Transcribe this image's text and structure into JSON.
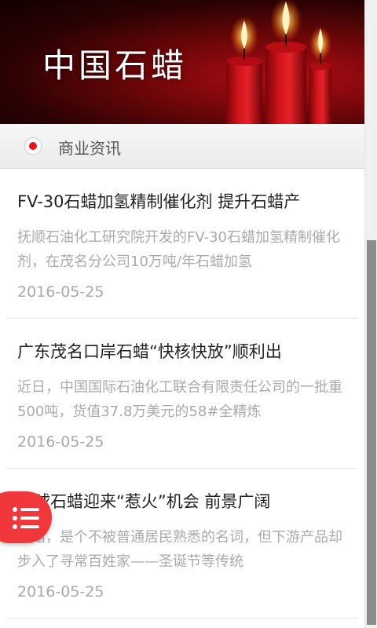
{
  "banner": {
    "title": "中国石蜡"
  },
  "section": {
    "title": "商业资讯"
  },
  "news": [
    {
      "title": "FV-30石蜡加氢精制催化剂 提升石蜡产",
      "summary": "抚顺石油化工研究院开发的FV-30石蜡加氢精制催化剂，在茂名分公司10万吨/年石蜡加氢",
      "date": "2016-05-25"
    },
    {
      "title": "广东茂名口岸石蜡“快核快放”顺利出",
      "summary": "近日，中国国际石油化工联合有限责任公司的一批重500吨，货值37.8万美元的58#全精炼",
      "date": "2016-05-25"
    },
    {
      "title": "全球石蜡迎来“惹火”机会 前景广阔",
      "summary": "石蜡，是个不被普通居民熟悉的名词，但下游产品却步入了寻常百姓家——圣诞节等传统",
      "date": "2016-05-25"
    }
  ],
  "icons": {
    "section": "red-dot-icon",
    "menu": "menu-list-icon"
  },
  "colors": {
    "accent": "#e8141c",
    "menu_button": "#f0373b",
    "banner_dark": "#2a0203",
    "banner_red": "#b00d14"
  }
}
